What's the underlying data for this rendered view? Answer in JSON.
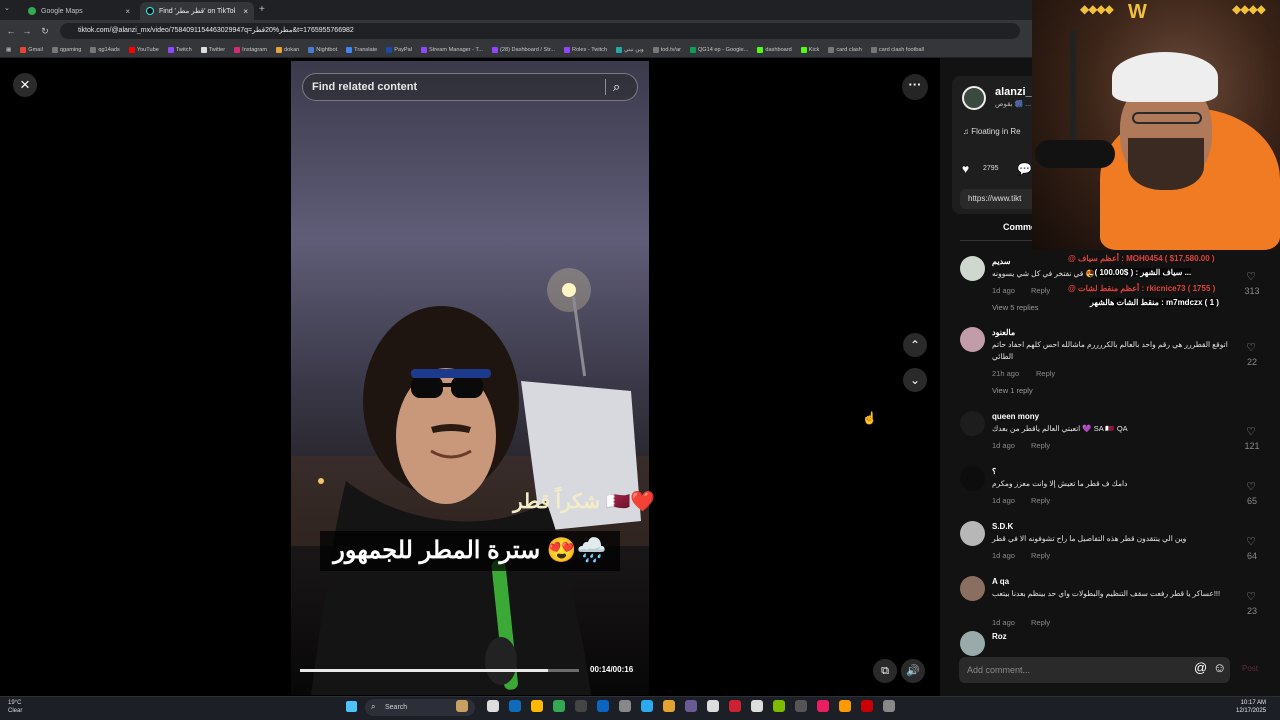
{
  "tabs": [
    {
      "label": "Google Maps",
      "close": "×"
    },
    {
      "label": "Find 'قطر مطر' on TikTok |",
      "close": "×"
    },
    {
      "label": "+"
    }
  ],
  "address": {
    "url": "tiktok.com/@alanzi_mx/video/7584091154463029947q=مطر%20قطر&t=1765955766982"
  },
  "bookmarks": [
    "Gmail",
    "qgaming",
    "qg14ads",
    "YouTube",
    "Twitch",
    "Twitter",
    "Instagram",
    "dokan",
    "Nightbot",
    "Translate",
    "PayPal",
    "Stream Manager - T...",
    "(28) Dashboard / Str...",
    "Roles - Twitch",
    "وين نبني",
    "tod.tv/ar",
    "QG14 ep - Google...",
    "dashboard",
    "Kick",
    "card clash",
    "card clash football"
  ],
  "video": {
    "search_placeholder": "Find related content",
    "caption1": "شكراً قطر 🇶🇦❤️",
    "caption2": "سترة المطر للجمهور 😍🌧️",
    "time": "00:14/00:16",
    "progress": 0.89
  },
  "author": {
    "name": "alanzi_",
    "subtitle": "بقوص 🎆 ...",
    "music": "Floating in Re",
    "likes": "2795",
    "url": "https://www.tikt"
  },
  "comments_tab": "Comme",
  "comments": [
    {
      "name": "سديم",
      "text": "قي نفتخر في كل شي يسوونه 😍",
      "time": "1d ago",
      "reply": "Reply",
      "views": "View 5 replies",
      "count": "313"
    },
    {
      "name": "مالعنود",
      "text": "اتوقع القطررر هي رقم واحد بالعالم بالكررررم ماشالله احس كلهم احفاد حاتم الطائي",
      "time": "21h ago",
      "reply": "Reply",
      "views": "View 1 reply",
      "count": "22"
    },
    {
      "name": "queen mony",
      "text": "اتعبتي العالم ياقطر من بعدك 💜 SA 🇶🇦 QA",
      "time": "1d ago",
      "reply": "Reply",
      "count": "121"
    },
    {
      "name": "؟",
      "text": "دامك ف قطر ما تعيش إلا وانت معزز ومكرم",
      "time": "1d ago",
      "reply": "Reply",
      "count": "65"
    },
    {
      "name": "S.D.K",
      "text": "وين الي ينتقدون قطر هذه التفاصيل ما راح تشوفونه الا في قطر",
      "time": "1d ago",
      "reply": "Reply",
      "count": "64"
    },
    {
      "name": "A qa",
      "text": "عساكر يا قطر رفعت سقف التنظيم والبطولات واي حد بينظم بعدنا بيتعب!!!",
      "time": "1d ago",
      "reply": "Reply",
      "count": "23"
    },
    {
      "name": "Roz",
      "text": "",
      "time": "",
      "reply": "",
      "count": ""
    }
  ],
  "add_comment": {
    "placeholder": "Add comment...",
    "post": "Post"
  },
  "stream_overlay": {
    "line1": "@ أعظم سياف : MOH0454 ( $17,580.00 )",
    "line2": "سياف الشهر : ( $100.00 ) ـ ...",
    "line3": "@ أعظم منقط لشات : rkicnice73 ( 1755 )",
    "line4": "منقط الشات هالشهر : m7mdczx ( 1 )"
  },
  "taskbar": {
    "weather_temp": "19°C",
    "weather_desc": "Clear",
    "search": "Search",
    "time": "10:17 AM",
    "date": "12/17/2025"
  },
  "colors": {
    "accent": "#fe2c55",
    "panel": "#121212",
    "overlay_gold": "#f0c23a"
  }
}
